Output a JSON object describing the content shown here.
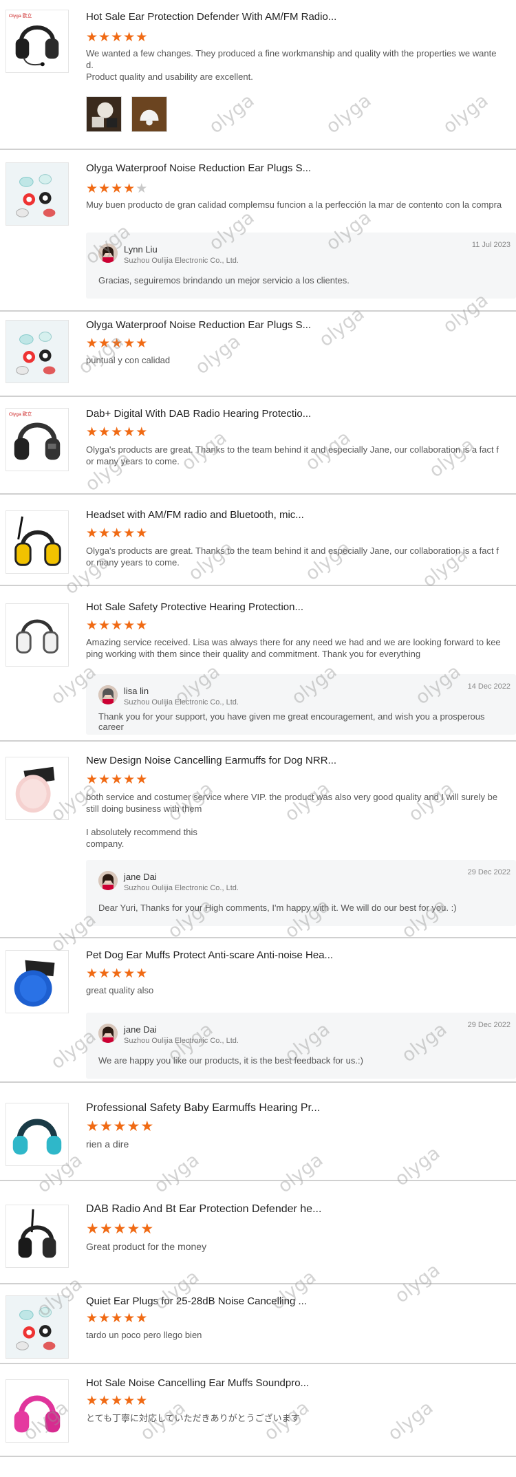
{
  "watermark": "olyga",
  "star_color": "#f06a14",
  "reviews": [
    {
      "product": "Hot Sale Ear Protection Defender With AM/FM Radio...",
      "rating": 5,
      "text": "We wanted a few changes. They produced a fine workmanship and quality with the properties we wanted.\nProduct quality and usability are excellent.",
      "image": "earmuff-headset-mic",
      "photos": [
        "review-photo-1",
        "review-photo-2"
      ]
    },
    {
      "product": "Olyga Waterproof Noise Reduction Ear Plugs S...",
      "rating": 4,
      "text": "Muy buen producto de gran calidad complemsu funcion a la perfección la mar de contento con la compra",
      "image": "ear-plugs",
      "reply": {
        "name": "Lynn Liu",
        "company": "Suzhou Oulijia Electronic Co., Ltd.",
        "date": "11 Jul 2023",
        "message": "Gracias, seguiremos brindando un mejor servicio a los clientes."
      }
    },
    {
      "product": "Olyga Waterproof Noise Reduction Ear Plugs S...",
      "rating": 5,
      "text": "puntual y con calidad",
      "image": "ear-plugs"
    },
    {
      "product": "Dab+ Digital With DAB Radio Hearing Protectio...",
      "rating": 5,
      "text": "Olyga's products are great. Thanks to the team behind it and especially Jane, our collaboration is a fact for many years to come.",
      "image": "earmuff-dab-radio"
    },
    {
      "product": "Headset with AM/FM radio and Bluetooth, mic...",
      "rating": 5,
      "text": "Olyga's products are great. Thanks to the team behind it and especially Jane, our collaboration is a fact for many years to come.",
      "image": "earmuff-yellow-antenna"
    },
    {
      "product": "Hot Sale Safety Protective Hearing Protection...",
      "rating": 5,
      "text": "Amazing service received. Lisa was always there for any need we had and we are looking forward to keeping working with them since their quality and commitment. Thank you for everything",
      "image": "earmuff-white",
      "reply": {
        "name": "lisa lin",
        "company": "Suzhou Oulijia Electronic Co., Ltd.",
        "date": "14 Dec 2022",
        "message": "Thank you for your support, you have given me great encouragement, and wish you a prosperous career"
      }
    },
    {
      "product": "New Design Noise Cancelling Earmuffs for Dog NRR...",
      "rating": 5,
      "text": "both service and costumer service where VIP. the product was also very good quality and I will surely be still doing business with them\n\nI absolutely recommend this\ncompany.",
      "image": "dog-earmuff-pink",
      "reply": {
        "name": "jane Dai",
        "company": "Suzhou Oulijia Electronic Co., Ltd.",
        "date": "29 Dec 2022",
        "message": "Dear Yuri, Thanks for your High comments, I'm happy with it. We will do our best for you. :)"
      }
    },
    {
      "product": "Pet Dog Ear Muffs Protect Anti-scare Anti-noise Hea...",
      "rating": 5,
      "text": "great quality also",
      "image": "dog-earmuff-blue",
      "reply": {
        "name": "jane Dai",
        "company": "Suzhou Oulijia Electronic Co., Ltd.",
        "date": "29 Dec 2022",
        "message": "We are happy you like our products, it is the best feedback for us.:)"
      }
    },
    {
      "product": "Professional Safety Baby Earmuffs Hearing Pr...",
      "rating": 5,
      "text": "rien a dire",
      "image": "baby-earmuff-teal"
    },
    {
      "product": "DAB Radio And Bt Ear Protection Defender he...",
      "rating": 5,
      "text": "Great product for the money",
      "image": "earmuff-black-antenna"
    },
    {
      "product": "Quiet Ear Plugs for 25-28dB Noise Cancelling ...",
      "rating": 5,
      "text": "tardo un poco pero llego bien",
      "image": "ear-plugs"
    },
    {
      "product": "Hot Sale Noise Cancelling Ear Muffs Soundpro...",
      "rating": 5,
      "text": "とても丁寧に対応していただきありがとうございます",
      "image": "earmuff-pink"
    }
  ]
}
